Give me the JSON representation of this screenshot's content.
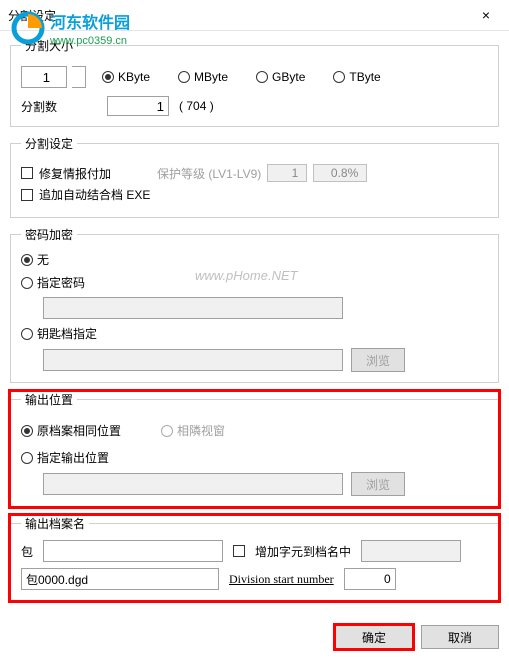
{
  "window": {
    "title": "分割设定",
    "close_label": "×"
  },
  "watermark": {
    "site_cn": "河东软件园",
    "site_url": "www.pc0359.cn",
    "center": "www.pHome.NET"
  },
  "split_size": {
    "legend": "分割大小",
    "value": "1",
    "units": {
      "kbyte": "KByte",
      "mbyte": "MByte",
      "gbyte": "GByte",
      "tbyte": "TByte"
    },
    "count_label": "分割数",
    "count_value": "1",
    "count_total": "( 704 )"
  },
  "split_settings": {
    "legend": "分割设定",
    "repair_report": "修复情报付加",
    "protect_level": "保护等级 (LV1-LV9)",
    "protect_value": "1",
    "protect_percent": "0.8%",
    "auto_combine": "追加自动结合档 EXE"
  },
  "password": {
    "legend": "密码加密",
    "none": "无",
    "specify": "指定密码",
    "keyfile": "钥匙档指定",
    "browse": "浏览"
  },
  "output": {
    "legend": "输出位置",
    "same_location": "原档案相同位置",
    "adjacent_window": "相隣视窗",
    "specify_location": "指定输出位置",
    "browse": "浏览"
  },
  "output_name": {
    "legend": "输出档案名",
    "prefix_label": "包",
    "prefix_value": "",
    "add_chars": "增加字元到档名中",
    "add_chars_value": "",
    "file_value": "包0000.dgd",
    "start_number_label": "Division start number",
    "start_number_value": "0"
  },
  "footer": {
    "ok": "确定",
    "cancel": "取消"
  }
}
